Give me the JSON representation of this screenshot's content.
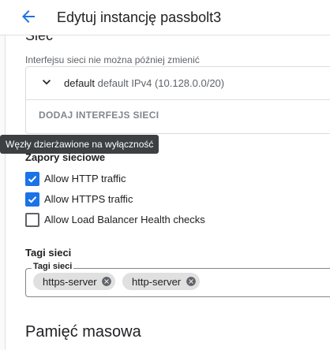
{
  "header": {
    "title": "Edytuj instancję passbolt3"
  },
  "network": {
    "hint": "Interfejsu sieci nie można później zmienić",
    "interface": {
      "name": "default",
      "detail": "default IPv4 (10.128.0.0/20)"
    },
    "add_interface_label": "DODAJ INTERFEJS SIECI"
  },
  "tooltip": {
    "text": "Węzły dzierżawione na wyłączność"
  },
  "firewall": {
    "title": "Zapory sieciowe",
    "options": [
      {
        "label": "Allow HTTP traffic",
        "checked": true
      },
      {
        "label": "Allow HTTPS traffic",
        "checked": true
      },
      {
        "label": "Allow Load Balancer Health checks",
        "checked": false
      }
    ]
  },
  "tags": {
    "title": "Tagi sieci",
    "field_label": "Tagi sieci",
    "chips": [
      "https-server",
      "http-server"
    ]
  },
  "storage": {
    "title": "Pamięć masowa"
  },
  "colors": {
    "accent": "#1a73e8",
    "tooltip_bg": "#3c4043",
    "chip_bg": "#e0e0e0"
  },
  "icons": {
    "back": "arrow-back-icon",
    "expand": "chevron-down-icon",
    "checkbox_checked": "check-icon",
    "chip_remove": "cancel-circle-icon"
  }
}
